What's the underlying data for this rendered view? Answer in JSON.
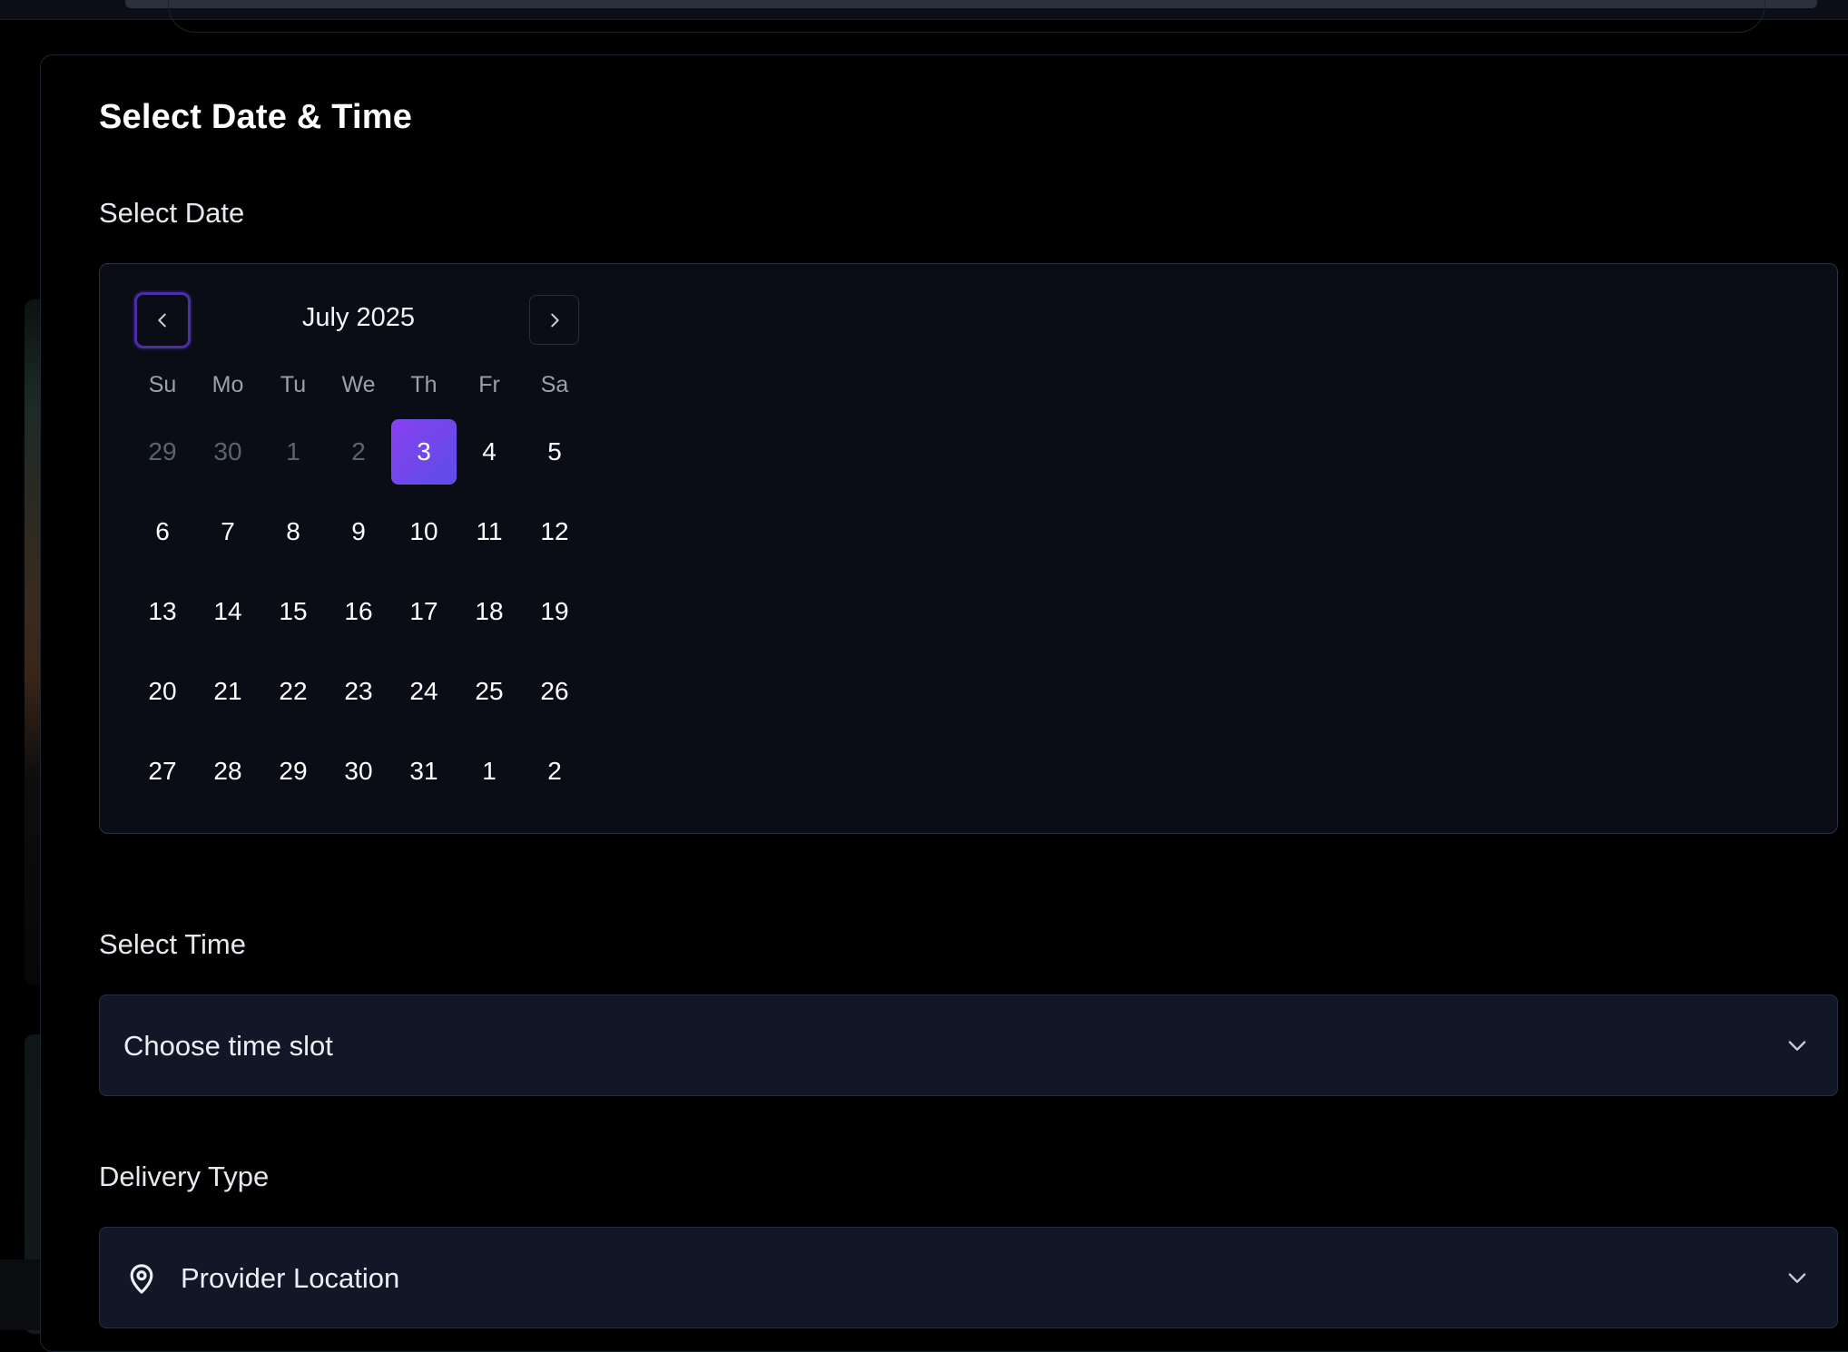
{
  "page": {
    "title": "Select Date & Time"
  },
  "date_section": {
    "label": "Select Date"
  },
  "calendar": {
    "month_label": "July 2025",
    "prev_icon": "chevron-left-icon",
    "next_icon": "chevron-right-icon",
    "weekdays": [
      "Su",
      "Mo",
      "Tu",
      "We",
      "Th",
      "Fr",
      "Sa"
    ],
    "weeks": [
      [
        {
          "d": "29",
          "muted": true
        },
        {
          "d": "30",
          "muted": true
        },
        {
          "d": "1",
          "muted": true
        },
        {
          "d": "2",
          "muted": true
        },
        {
          "d": "3",
          "selected": true
        },
        {
          "d": "4"
        },
        {
          "d": "5"
        }
      ],
      [
        {
          "d": "6"
        },
        {
          "d": "7"
        },
        {
          "d": "8"
        },
        {
          "d": "9"
        },
        {
          "d": "10"
        },
        {
          "d": "11"
        },
        {
          "d": "12"
        }
      ],
      [
        {
          "d": "13"
        },
        {
          "d": "14"
        },
        {
          "d": "15"
        },
        {
          "d": "16"
        },
        {
          "d": "17"
        },
        {
          "d": "18"
        },
        {
          "d": "19"
        }
      ],
      [
        {
          "d": "20"
        },
        {
          "d": "21"
        },
        {
          "d": "22"
        },
        {
          "d": "23"
        },
        {
          "d": "24"
        },
        {
          "d": "25"
        },
        {
          "d": "26"
        }
      ],
      [
        {
          "d": "27"
        },
        {
          "d": "28"
        },
        {
          "d": "29"
        },
        {
          "d": "30"
        },
        {
          "d": "31"
        },
        {
          "d": "1",
          "muted": false
        },
        {
          "d": "2",
          "muted": false
        }
      ]
    ],
    "selected_color_start": "#8a3ff0",
    "selected_color_end": "#5b4ee8"
  },
  "time_section": {
    "label": "Select Time",
    "placeholder": "Choose time slot",
    "icon": "chevron-down-icon"
  },
  "delivery_section": {
    "label": "Delivery Type",
    "value": "Provider Location",
    "leading_icon": "map-pin-icon",
    "icon": "chevron-down-icon"
  }
}
